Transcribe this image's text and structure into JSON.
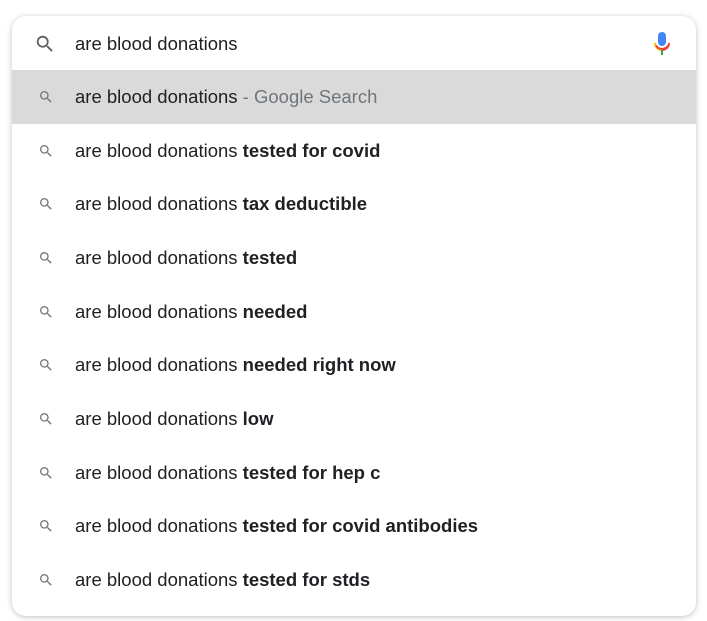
{
  "search": {
    "query": "are blood donations",
    "search_icon": "search-icon",
    "mic_icon": "microphone-icon"
  },
  "suggestions": [
    {
      "prefix": "are blood donations",
      "completion": "",
      "suffix": " - Google Search",
      "highlighted": true
    },
    {
      "prefix": "are blood donations ",
      "completion": "tested for covid",
      "suffix": "",
      "highlighted": false
    },
    {
      "prefix": "are blood donations ",
      "completion": "tax deductible",
      "suffix": "",
      "highlighted": false
    },
    {
      "prefix": "are blood donations ",
      "completion": "tested",
      "suffix": "",
      "highlighted": false
    },
    {
      "prefix": "are blood donations ",
      "completion": "needed",
      "suffix": "",
      "highlighted": false
    },
    {
      "prefix": "are blood donations ",
      "completion": "needed right now",
      "suffix": "",
      "highlighted": false
    },
    {
      "prefix": "are blood donations ",
      "completion": "low",
      "suffix": "",
      "highlighted": false
    },
    {
      "prefix": "are blood donations ",
      "completion": "tested for hep c",
      "suffix": "",
      "highlighted": false
    },
    {
      "prefix": "are blood donations ",
      "completion": "tested for covid antibodies",
      "suffix": "",
      "highlighted": false
    },
    {
      "prefix": "are blood donations ",
      "completion": "tested for stds",
      "suffix": "",
      "highlighted": false
    }
  ],
  "colors": {
    "highlight_bg": "#dadada",
    "text": "#202124",
    "suffix_text": "#70757a",
    "mic_blue": "#4285f4",
    "mic_red": "#ea4335",
    "mic_yellow": "#fbbc05",
    "mic_green": "#34a853"
  }
}
